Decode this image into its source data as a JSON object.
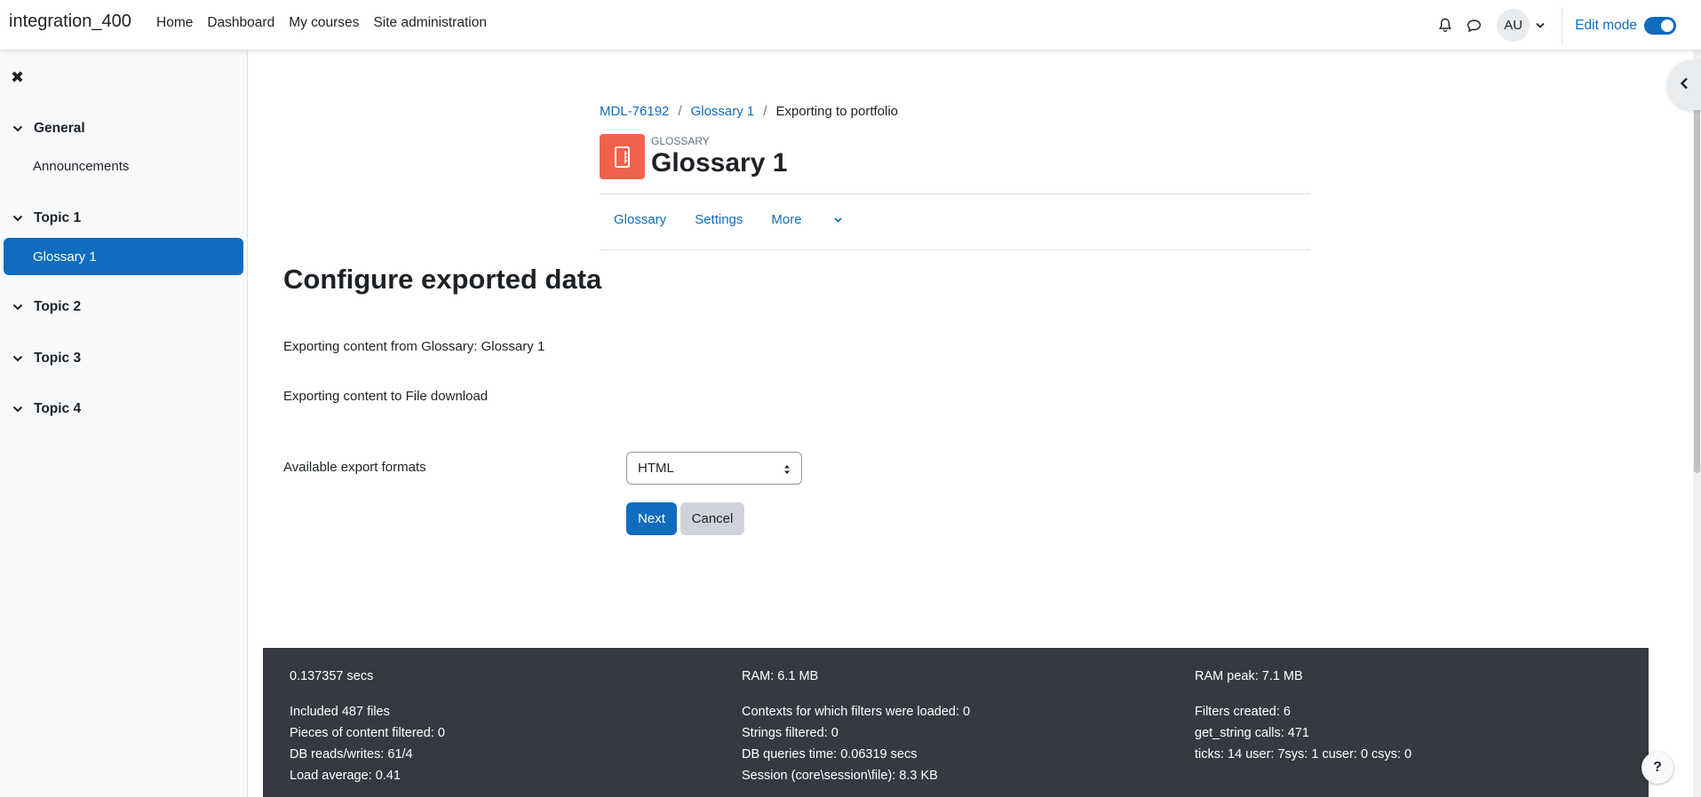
{
  "navbar": {
    "brand": "integration_400",
    "links": [
      "Home",
      "Dashboard",
      "My courses",
      "Site administration"
    ],
    "avatar_initials": "AU",
    "edit_mode_label": "Edit mode"
  },
  "drawer": {
    "close_glyph": "✖",
    "sections": [
      {
        "title": "General",
        "items": [
          "Announcements"
        ]
      },
      {
        "title": "Topic 1",
        "items": [
          "Glossary 1"
        ]
      },
      {
        "title": "Topic 2",
        "items": []
      },
      {
        "title": "Topic 3",
        "items": []
      },
      {
        "title": "Topic 4",
        "items": []
      }
    ]
  },
  "breadcrumb": [
    "MDL-76192",
    "Glossary 1",
    "Exporting to portfolio"
  ],
  "header": {
    "module_type": "GLOSSARY",
    "title": "Glossary 1"
  },
  "secondary_nav": [
    "Glossary",
    "Settings",
    "More"
  ],
  "main": {
    "heading": "Configure exported data",
    "exporting_from": "Exporting content from Glossary: Glossary 1",
    "exporting_to": "Exporting content to File download",
    "formats_label": "Available export formats",
    "formats_selected": "HTML",
    "next_label": "Next",
    "cancel_label": "Cancel"
  },
  "footer": {
    "col1": [
      "0.137357 secs",
      "Included 487 files",
      "Pieces of content filtered: 0",
      "DB reads/writes: 61/4",
      "Load average: 0.41"
    ],
    "col2": [
      "RAM: 6.1 MB",
      "Contexts for which filters were loaded: 0",
      "Strings filtered: 0",
      "DB queries time: 0.06319 secs",
      "Session (core\\session\\file): 8.3 KB"
    ],
    "col3": [
      "RAM peak: 7.1 MB",
      "Filters created: 6",
      "get_string calls: 471",
      "ticks: 14 user: 7sys: 1 cuser: 0 csys: 0"
    ]
  },
  "help_glyph": "?",
  "colors": {
    "primary": "#0f6cbf",
    "activity_icon": "#f0624d",
    "footer_bg": "#343a40"
  }
}
